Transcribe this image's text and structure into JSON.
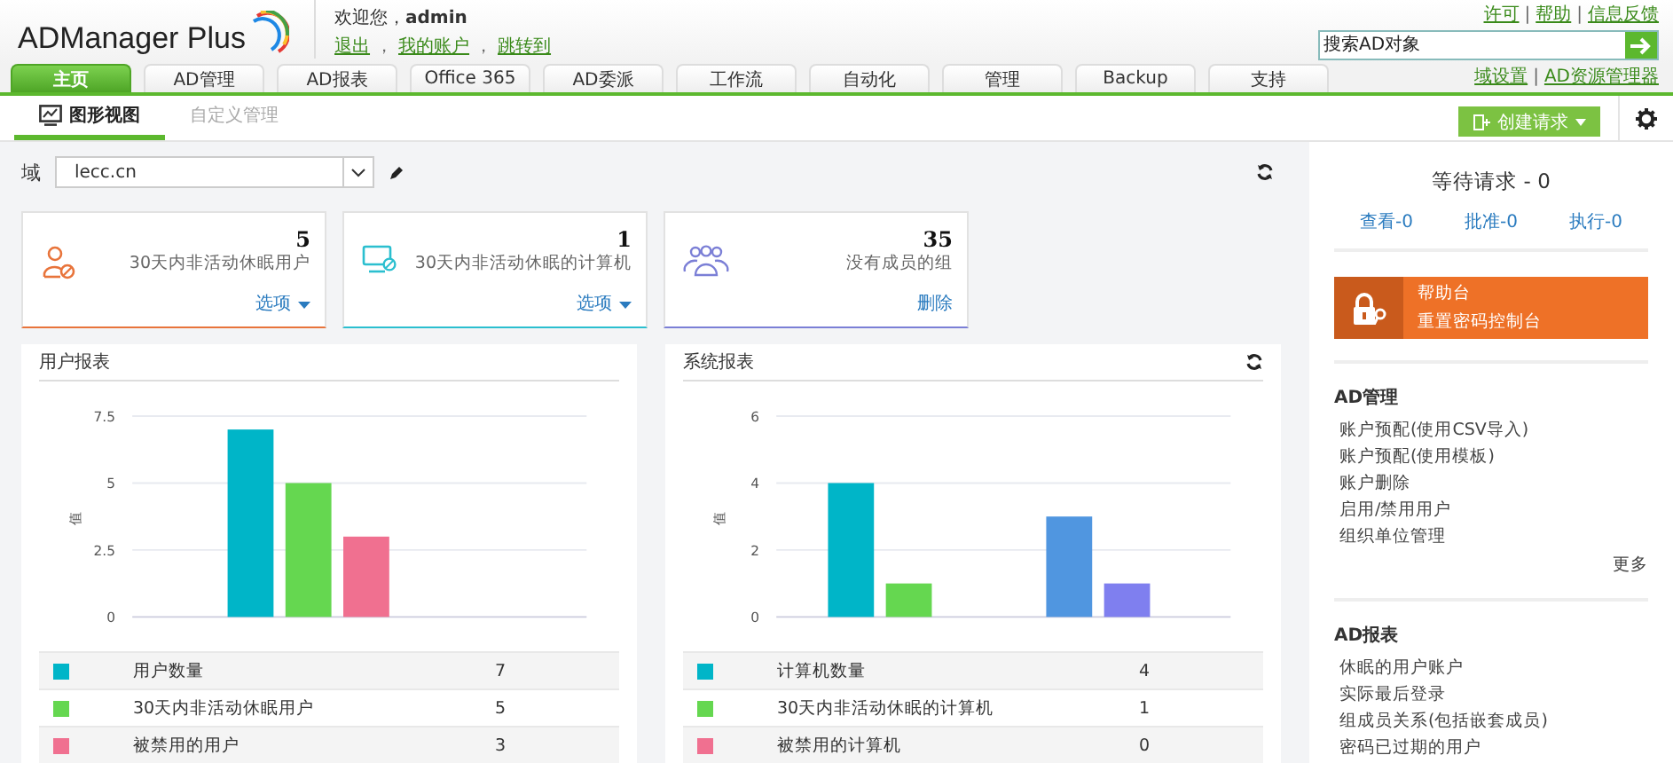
{
  "header": {
    "logo": "ADManager Plus",
    "welcome": "欢迎您，",
    "user": "admin",
    "user_links": [
      "退出",
      "我的账户",
      "跳转到"
    ],
    "user_link_separator": "，",
    "top_links": [
      "许可",
      "帮助",
      "信息反馈"
    ],
    "link_separator": "|",
    "search": {
      "placeholder": "搜索AD对象"
    }
  },
  "tabs": [
    {
      "label": "主页",
      "selected": true
    },
    {
      "label": "AD管理",
      "selected": false
    },
    {
      "label": "AD报表",
      "selected": false
    },
    {
      "label": "Office 365",
      "selected": false
    },
    {
      "label": "AD委派",
      "selected": false
    },
    {
      "label": "工作流",
      "selected": false
    },
    {
      "label": "自动化",
      "selected": false
    },
    {
      "label": "管理",
      "selected": false
    },
    {
      "label": "Backup",
      "selected": false
    },
    {
      "label": "支持",
      "selected": false
    }
  ],
  "tab_links": [
    "域设置",
    "AD资源管理器"
  ],
  "subtabs": [
    {
      "label": "图形视图",
      "selected": true
    },
    {
      "label": "自定义管理",
      "selected": false
    }
  ],
  "create_button": "创建请求",
  "domain": {
    "label": "域",
    "value": "lecc.cn"
  },
  "cards": [
    {
      "kind": "user",
      "count": "5",
      "label": "30天内非活动休眠用户",
      "action": "选项",
      "dropdown": true,
      "color": "#e8743b"
    },
    {
      "kind": "computer",
      "count": "1",
      "label": "30天内非活动休眠的计算机",
      "action": "选项",
      "dropdown": true,
      "color": "#2bbfcf"
    },
    {
      "kind": "group",
      "count": "35",
      "label": "没有成员的组",
      "action": "删除",
      "dropdown": false,
      "color": "#7b7fd6"
    }
  ],
  "reports": [
    {
      "title": "用户报表",
      "refresh": false,
      "chart_data": {
        "type": "bar",
        "ylabel": "值",
        "ylim": [
          0,
          7.5
        ],
        "yticks": [
          0,
          2.5,
          5,
          7.5
        ],
        "series": [
          {
            "color": "#00b5c8",
            "values": [
              7
            ]
          },
          {
            "color": "#65d750",
            "values": [
              5
            ]
          },
          {
            "color": "#f07090",
            "values": [
              3
            ]
          }
        ]
      },
      "legend": [
        {
          "label": "用户数量",
          "value": "7",
          "color": "#00b5c8"
        },
        {
          "label": "30天内非活动休眠用户",
          "value": "5",
          "color": "#65d750"
        },
        {
          "label": "被禁用的用户",
          "value": "3",
          "color": "#f07090"
        }
      ]
    },
    {
      "title": "系统报表",
      "refresh": true,
      "chart_data": {
        "type": "bar",
        "ylabel": "值",
        "ylim": [
          0,
          6
        ],
        "yticks": [
          0,
          2,
          4,
          6
        ],
        "series": [
          {
            "color": "#00b5c8",
            "values": [
              4,
              null
            ]
          },
          {
            "color": "#65d750",
            "values": [
              1,
              null
            ]
          },
          {
            "color": "#f07090",
            "values": [
              0,
              null
            ]
          },
          {
            "color": "#5096e0",
            "values": [
              null,
              3
            ]
          },
          {
            "color": "#7f7fef",
            "values": [
              null,
              1
            ]
          }
        ]
      },
      "legend": [
        {
          "label": "计算机数量",
          "value": "4",
          "color": "#00b5c8"
        },
        {
          "label": "30天内非活动休眠的计算机",
          "value": "1",
          "color": "#65d750"
        },
        {
          "label": "被禁用的计算机",
          "value": "0",
          "color": "#f07090"
        }
      ]
    }
  ],
  "sidebar": {
    "pending_title": "等待请求 - 0",
    "pending_links": [
      "查看-0",
      "批准-0",
      "执行-0"
    ],
    "helpdesk": [
      "帮助台",
      "重置密码控制台"
    ],
    "sections": [
      {
        "title": "AD管理",
        "items": [
          "账户预配(使用CSV导入)",
          "账户预配(使用模板)",
          "账户删除",
          "启用/禁用用户",
          "组织单位管理"
        ],
        "more": "更多"
      },
      {
        "title": "AD报表",
        "items": [
          "休眠的用户账户",
          "实际最后登录",
          "组成员关系(包括嵌套成员)",
          "密码已过期的用户"
        ]
      }
    ]
  }
}
